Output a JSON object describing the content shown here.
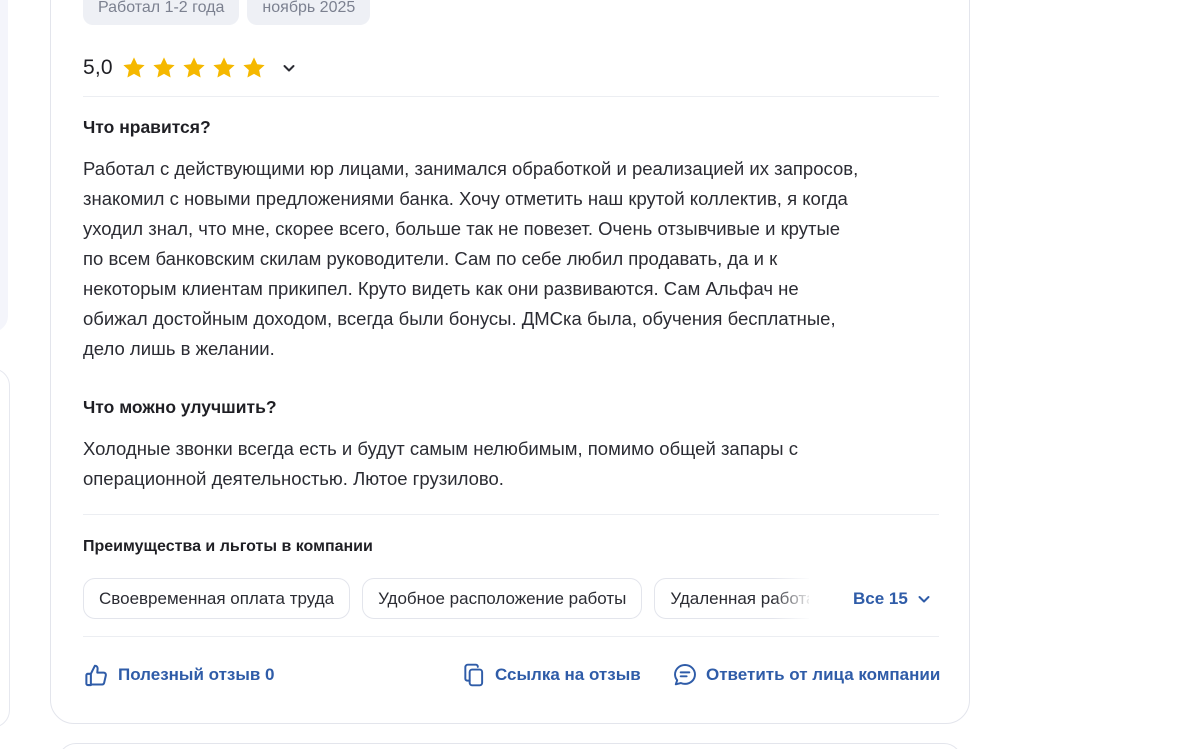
{
  "review": {
    "meta_tags": [
      "Работал 1-2 года",
      "ноябрь 2025"
    ],
    "rating": {
      "value": "5,0",
      "stars": 5,
      "star_color": "#f5b800"
    },
    "pros": {
      "heading": "Что нравится?",
      "lines": [
        "Работал с действующими юр лицами, занимался обработкой и реализацией их запросов,",
        "знакомил с новыми предложениями банка. Хочу отметить наш крутой коллектив, я когда",
        "уходил знал, что мне, скорее всего, больше так не повезет. Очень отзывчивые и крутые",
        "по всем банковским скилам руководители. Сам по себе любил продавать, да и к",
        "некоторым клиентам прикипел. Круто видеть как они развиваются. Сам Альфач не",
        "обижал достойным доходом, всегда были бонусы. ДМСка была, обучения бесплатные,",
        "дело лишь в желании."
      ]
    },
    "cons": {
      "heading": "Что можно улучшить?",
      "lines": [
        "Холодные звонки всегда есть и будут самым нелюбимым, помимо общей запары с",
        "операционной деятельностью. Лютое грузилово."
      ]
    },
    "benefits": {
      "title": "Преимущества и льготы в компании",
      "chips": [
        "Своевременная оплата труда",
        "Удобное расположение работы",
        "Удаленная работа"
      ],
      "all_label": "Все 15"
    },
    "actions": {
      "helpful_label": "Полезный отзыв 0",
      "link_label": "Ссылка на отзыв",
      "reply_label": "Ответить от лица компании"
    }
  },
  "colors": {
    "accent": "#2f5ca8",
    "tag_bg": "#eef0f5",
    "text": "#1f1f24"
  },
  "icons": [
    "star-icon",
    "chevron-down-icon",
    "thumbs-up-icon",
    "copy-link-icon",
    "chat-bubble-icon"
  ]
}
